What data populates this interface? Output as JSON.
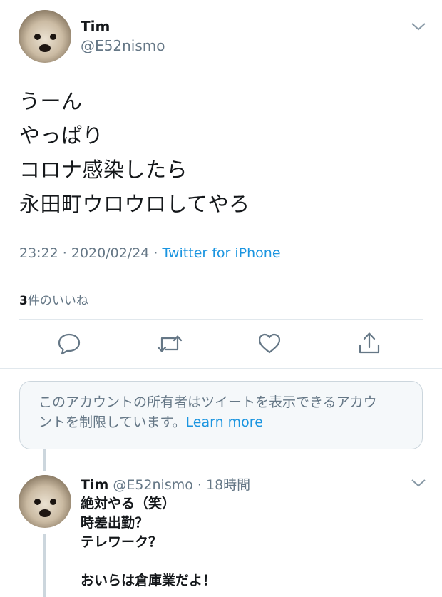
{
  "main_tweet": {
    "author_name": "Tim",
    "author_handle": "@E52nismo",
    "lines": [
      "うーん",
      "やっぱり",
      "コロナ感染したら",
      "永田町ウロウロしてやろ"
    ],
    "time": "23:22 · 2020/02/24 · ",
    "source": "Twitter for iPhone",
    "likes_count": "3",
    "likes_label": "件のいいね"
  },
  "actions": [
    "reply-icon",
    "retweet-icon",
    "like-icon",
    "share-icon"
  ],
  "notice": {
    "line1": "このアカウントの所有者はツイートを表示できるアカウ",
    "line2": "ントを制限しています。",
    "link": "Learn more"
  },
  "reply": {
    "author_name": "Tim",
    "author_handle": "@E52nismo",
    "age": " · 18時間",
    "lines": [
      "絶対やる（笑）",
      "時差出勤？",
      "テレワーク？",
      "",
      "おいらは倉庫業だよ！"
    ]
  },
  "colors": {
    "accent": "#1b95e0",
    "muted": "#657786",
    "border": "#e1e8ed"
  }
}
